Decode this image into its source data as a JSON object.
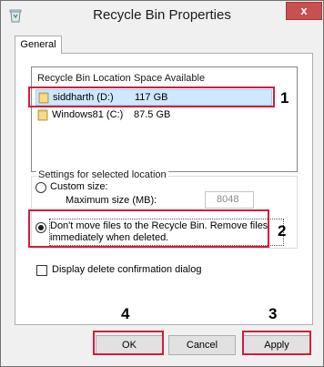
{
  "window": {
    "title": "Recycle Bin Properties",
    "close_label": "x"
  },
  "tabs": [
    {
      "label": "General"
    }
  ],
  "locations": {
    "col_location": "Recycle Bin Location",
    "col_space": "Space Available",
    "rows": [
      {
        "name": "siddharth (D:)",
        "space": "117 GB",
        "selected": true
      },
      {
        "name": "Windows81 (C:)",
        "space": "87.5 GB",
        "selected": false
      }
    ]
  },
  "settings": {
    "group_label": "Settings for selected location",
    "custom_size_label": "Custom size:",
    "max_size_label": "Maximum size (MB):",
    "max_size_value": "8048",
    "dont_move_line1": "Don't move files to the Recycle Bin. Remove files",
    "dont_move_line2": "immediately when deleted."
  },
  "confirm_label": "Display delete confirmation dialog",
  "buttons": {
    "ok": "OK",
    "cancel": "Cancel",
    "apply": "Apply"
  },
  "annotations": {
    "n1": "1",
    "n2": "2",
    "n3": "3",
    "n4": "4",
    "color": "#d21d3a"
  }
}
